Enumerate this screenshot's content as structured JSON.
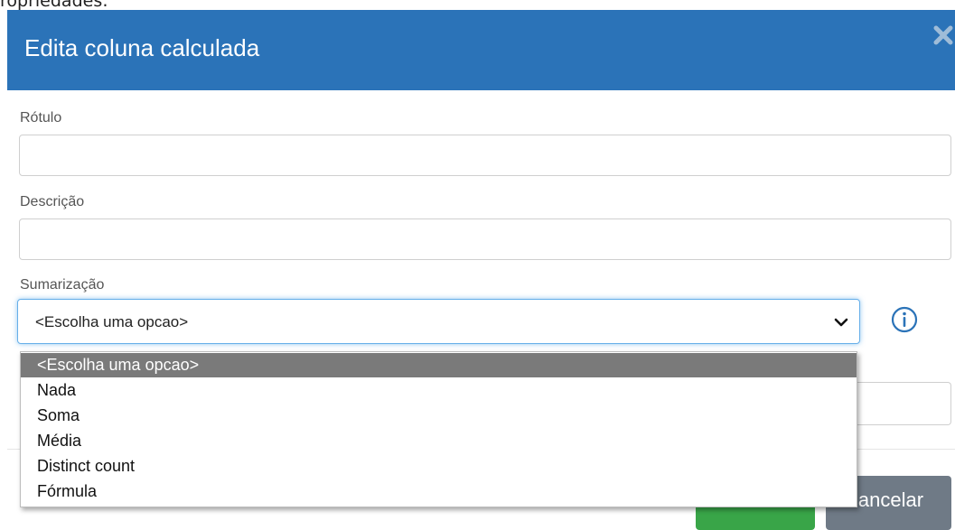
{
  "page": {
    "top_text": "ropriedades:"
  },
  "modal": {
    "title": "Edita coluna calculada",
    "close_icon": "close-icon",
    "header_color": "#2b73b8"
  },
  "form": {
    "rotulo": {
      "label": "Rótulo",
      "value": ""
    },
    "descricao": {
      "label": "Descrição",
      "value": ""
    },
    "sumarizacao": {
      "label": "Sumarização",
      "selected": "<Escolha uma opcao>",
      "info_icon": "info-icon",
      "options": [
        "<Escolha uma opcao>",
        "Nada",
        "Soma",
        "Média",
        "Distinct count",
        "Fórmula"
      ]
    }
  },
  "footer": {
    "cancel_label": "Cancelar",
    "confirm_color": "#39a548",
    "cancel_color": "#6f7a86"
  }
}
